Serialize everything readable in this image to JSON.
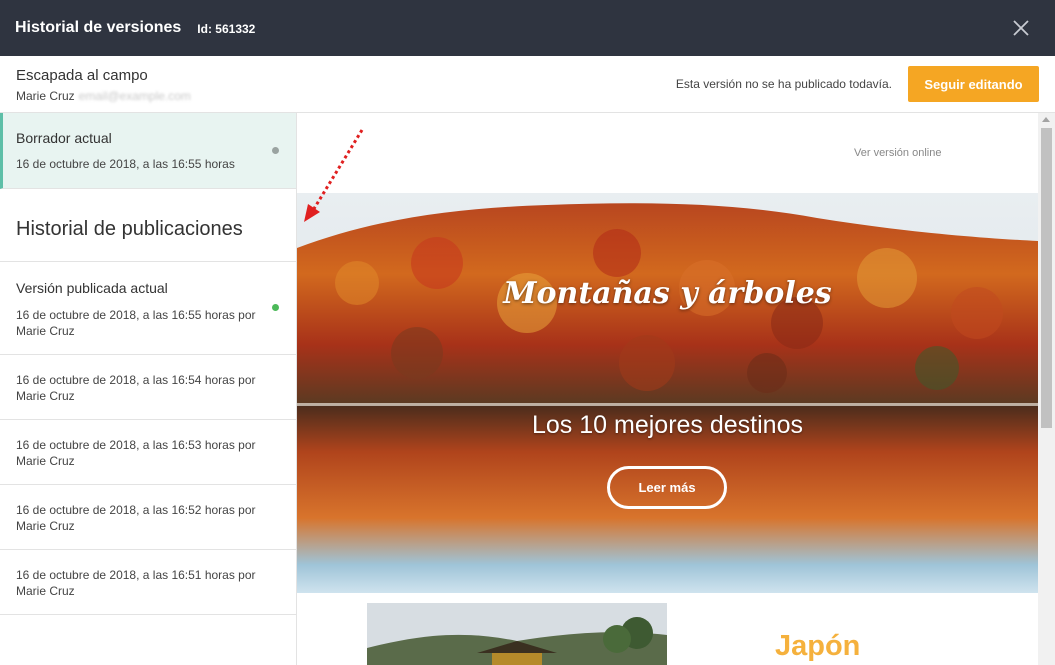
{
  "header": {
    "title": "Historial de versiones",
    "id_text": "Id: 561332"
  },
  "document": {
    "title": "Escapada al campo",
    "author": "Marie Cruz",
    "email": "email@example.com",
    "publish_status": "Esta versión no se ha publicado todavía.",
    "keep_editing_label": "Seguir editando"
  },
  "draft": {
    "label": "Borrador actual",
    "date": "16 de octubre de 2018, a las 16:55 horas",
    "dot_color": "#9aa3a1"
  },
  "history": {
    "heading": "Historial de publicaciones",
    "current": {
      "label": "Versión publicada actual",
      "date": "16 de octubre de 2018, a las 16:55 horas por",
      "author": "Marie Cruz",
      "dot_color": "#4cb959"
    },
    "items": [
      {
        "date": "16 de octubre de 2018, a las 16:54 horas por",
        "author": "Marie Cruz"
      },
      {
        "date": "16 de octubre de 2018, a las 16:53 horas por",
        "author": "Marie Cruz"
      },
      {
        "date": "16 de octubre de 2018, a las 16:52 horas por",
        "author": "Marie Cruz"
      },
      {
        "date": "16 de octubre de 2018, a las 16:51 horas por",
        "author": "Marie Cruz"
      }
    ]
  },
  "preview": {
    "online_link": "Ver versión online",
    "hero_title": "Montañas y árboles",
    "hero_subtitle": "Los 10 mejores destinos",
    "read_more": "Leer más",
    "country": "Japón"
  },
  "colors": {
    "topbar": "#2f3440",
    "accent": "#f5a623",
    "draft_bg": "#e8f4f1",
    "draft_border": "#5ebfa8"
  },
  "icons": {
    "close": "close-icon",
    "annotation_arrow": "dotted-arrow-icon"
  }
}
